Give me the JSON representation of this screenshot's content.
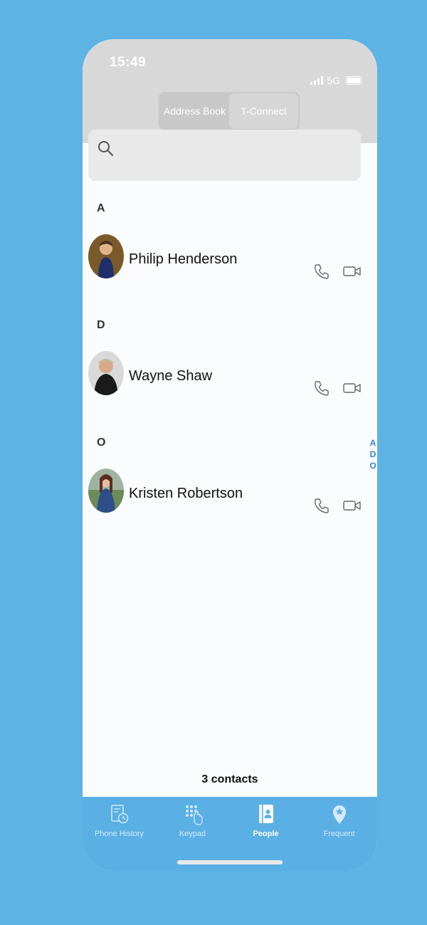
{
  "status_bar": {
    "time": "15:49",
    "network": "5G"
  },
  "segment": {
    "options": [
      "Address Book",
      "T-Connect"
    ],
    "selected": "T-Connect"
  },
  "search": {
    "placeholder": ""
  },
  "sections": [
    {
      "letter": "A",
      "contacts": [
        {
          "name": "Philip Henderson"
        }
      ]
    },
    {
      "letter": "D",
      "contacts": [
        {
          "name": "Wayne Shaw"
        }
      ]
    },
    {
      "letter": "O",
      "contacts": [
        {
          "name": "Kristen Robertson"
        }
      ]
    }
  ],
  "index_letters": [
    "A",
    "D",
    "O"
  ],
  "footer": {
    "count_text": "3 contacts"
  },
  "tabs": [
    {
      "label": "Phone History",
      "icon": "history-icon"
    },
    {
      "label": "Keypad",
      "icon": "keypad-icon"
    },
    {
      "label": "People",
      "icon": "contacts-icon",
      "active": true
    },
    {
      "label": "Frequent",
      "icon": "star-pin-icon"
    }
  ],
  "colors": {
    "background": "#5db3e3",
    "tabbar": "#5aafe4",
    "accent": "#2f86d4"
  }
}
